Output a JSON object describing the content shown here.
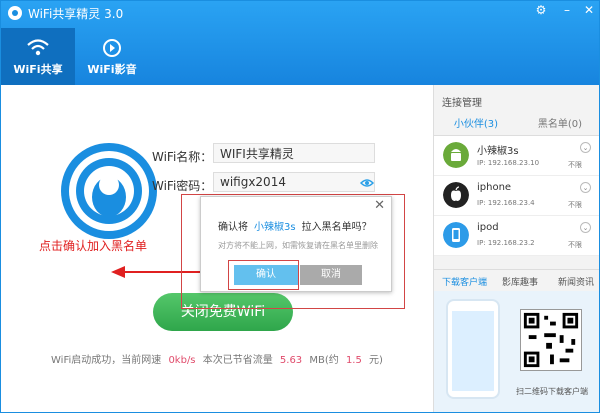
{
  "app": {
    "title": "WiFi共享精灵 3.0"
  },
  "window_controls": [
    {
      "name": "settings-icon",
      "glyph": "⚙"
    },
    {
      "name": "minimize-icon",
      "glyph": "–"
    },
    {
      "name": "close-icon",
      "glyph": "✕"
    }
  ],
  "nav": {
    "tabs": [
      {
        "label": "WiFi共享",
        "icon": "wifi-icon",
        "active": true
      },
      {
        "label": "WiFi影音",
        "icon": "play-icon",
        "active": false
      }
    ]
  },
  "main": {
    "wifi_name_label": "WiFi名称：",
    "wifi_name_value": "WIFI共享精灵",
    "wifi_password_label": "WiFi密码：",
    "wifi_password_value": "wifigx2014",
    "annotation": "点击确认加入黑名单",
    "close_wifi_button": "关闭免费WiFi",
    "status": {
      "prefix": "WiFi启动成功，当前网速",
      "speed": "0kb/s",
      "saved_label": "本次已节省流量",
      "saved_value": "5.63",
      "mb_label": "MB(约",
      "yuan_value": "1.5",
      "yuan_label": "元)"
    }
  },
  "dialog": {
    "question_prefix": "确认将",
    "device_name": "小辣椒3s",
    "question_suffix": "拉入黑名单吗？",
    "subtext": "对方将不能上网，如需恢复请在黑名单里删除",
    "confirm_label": "确认",
    "cancel_label": "取消",
    "close_glyph": "✕"
  },
  "right_panel": {
    "title": "连接管理",
    "tabs": [
      {
        "label": "小伙伴(3)",
        "active": true
      },
      {
        "label": "黑名单(0)",
        "active": false
      }
    ],
    "devices": [
      {
        "name": "小辣椒3s",
        "ip": "IP: 192.168.23.10",
        "limit": "不限",
        "icon": "android-icon",
        "color": "#6aaa3a"
      },
      {
        "name": "iphone",
        "ip": "IP: 192.168.23.4",
        "limit": "不限",
        "icon": "apple-icon",
        "color": "#222222"
      },
      {
        "name": "ipod",
        "ip": "IP: 192.168.23.2",
        "limit": "不限",
        "icon": "ipod-icon",
        "color": "#2d9be8"
      }
    ],
    "bottom_tabs": [
      "下载客户端",
      "影库趣事",
      "新闻资讯"
    ],
    "promo_text": "扫二维码下载客户端"
  },
  "colors": {
    "header": "#1a8ee0",
    "accent_green": "#2fa64b",
    "annotation_red": "#e02020",
    "link_blue": "#1a8ee0"
  }
}
